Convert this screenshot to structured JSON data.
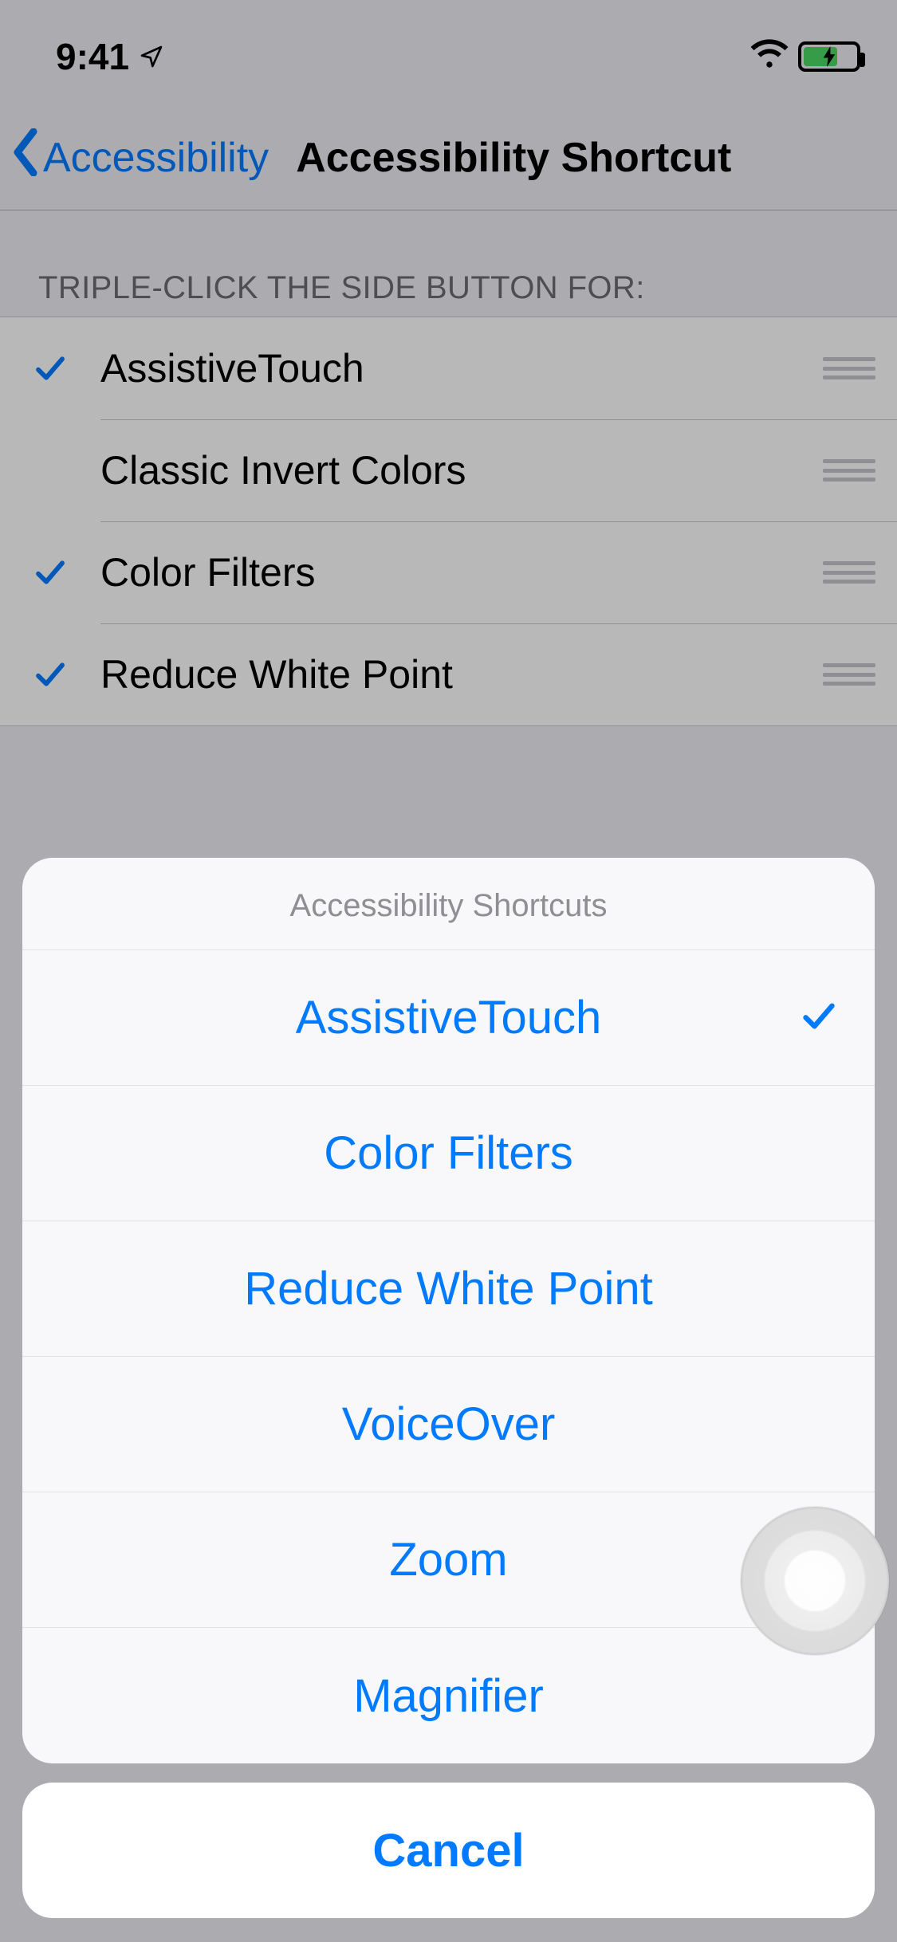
{
  "status": {
    "time": "9:41"
  },
  "nav": {
    "back_label": "Accessibility",
    "title": "Accessibility Shortcut"
  },
  "section": {
    "header": "TRIPLE-CLICK THE SIDE BUTTON FOR:"
  },
  "list": {
    "items": [
      {
        "label": "AssistiveTouch",
        "checked": true
      },
      {
        "label": "Classic Invert Colors",
        "checked": false
      },
      {
        "label": "Color Filters",
        "checked": true
      },
      {
        "label": "Reduce White Point",
        "checked": true
      }
    ]
  },
  "sheet": {
    "title": "Accessibility Shortcuts",
    "options": [
      {
        "label": "AssistiveTouch",
        "checked": true
      },
      {
        "label": "Color Filters",
        "checked": false
      },
      {
        "label": "Reduce White Point",
        "checked": false
      },
      {
        "label": "VoiceOver",
        "checked": false
      },
      {
        "label": "Zoom",
        "checked": false
      },
      {
        "label": "Magnifier",
        "checked": false
      }
    ],
    "cancel": "Cancel"
  },
  "colors": {
    "tint": "#007aff"
  }
}
